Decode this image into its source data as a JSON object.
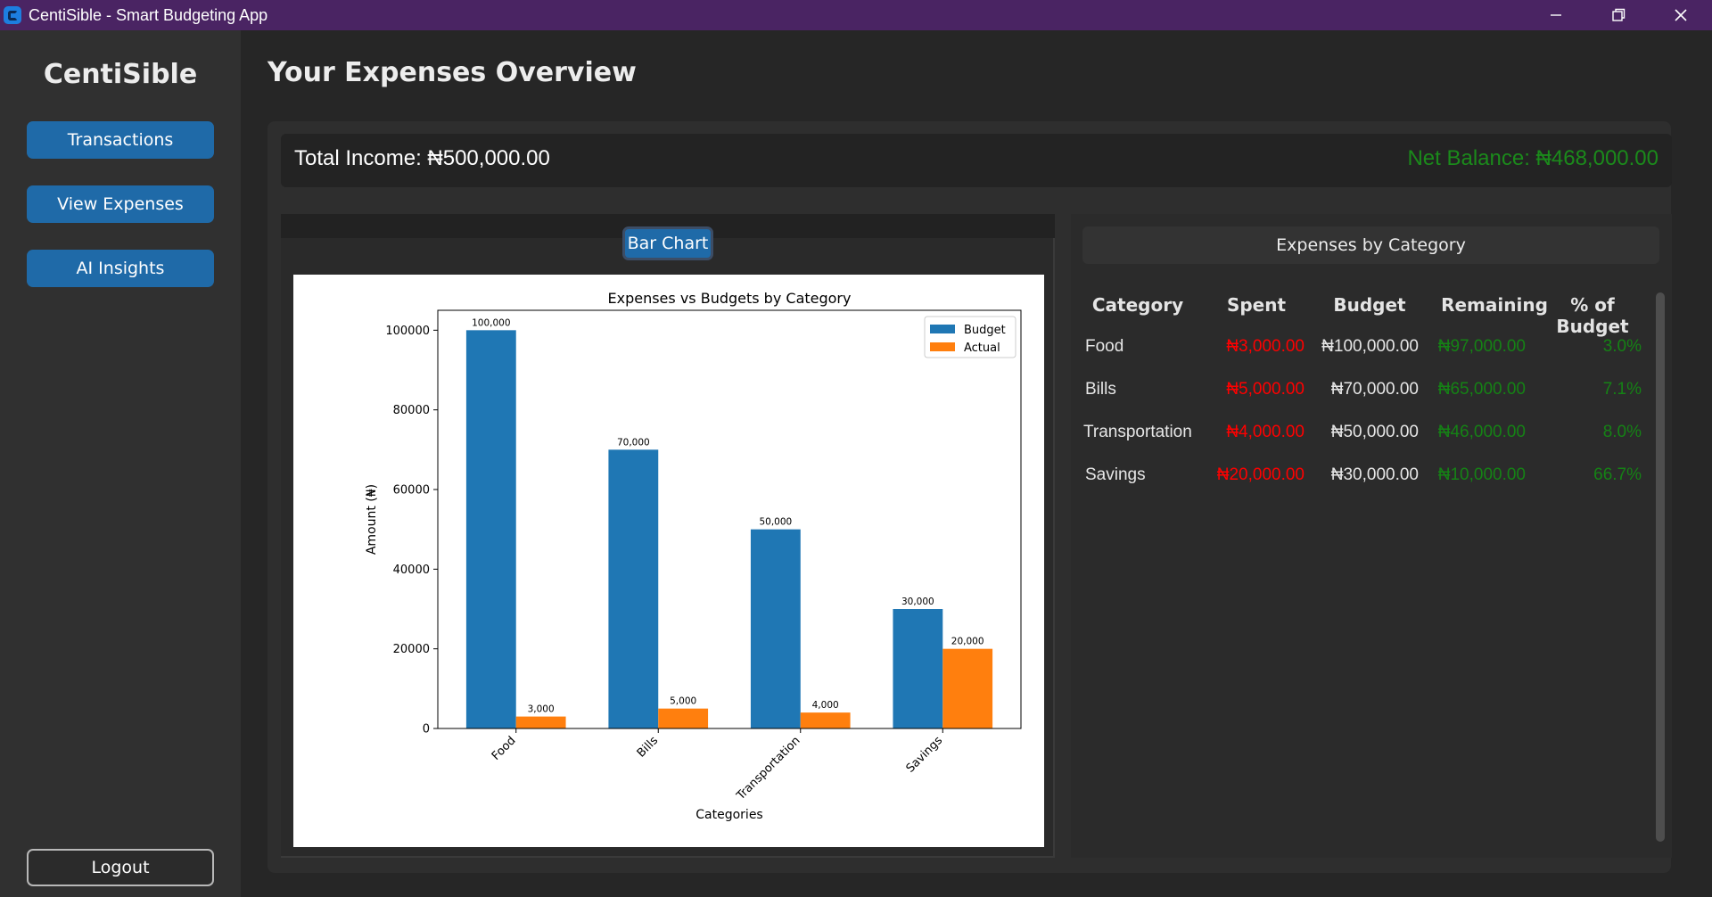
{
  "window": {
    "title": "CentiSible - Smart Budgeting App"
  },
  "sidebar": {
    "brand": "CentiSible",
    "nav": [
      {
        "label": "Transactions"
      },
      {
        "label": "View Expenses"
      },
      {
        "label": "AI Insights"
      }
    ],
    "logout_label": "Logout"
  },
  "page": {
    "title": "Your Expenses Overview"
  },
  "summary": {
    "income": "Total Income: ₦500,000.00",
    "balance": "Net Balance: ₦468,000.00"
  },
  "chart_tab": {
    "label": "Bar Chart"
  },
  "table": {
    "title": "Expenses by Category",
    "headers": [
      "Category",
      "Spent",
      "Budget",
      "Remaining",
      "% of Budget"
    ],
    "rows": [
      {
        "category": "Food",
        "spent": "₦3,000.00",
        "budget": "₦100,000.00",
        "remaining": "₦97,000.00",
        "percent": "3.0%"
      },
      {
        "category": "Bills",
        "spent": "₦5,000.00",
        "budget": "₦70,000.00",
        "remaining": "₦65,000.00",
        "percent": "7.1%"
      },
      {
        "category": "Transportation",
        "spent": "₦4,000.00",
        "budget": "₦50,000.00",
        "remaining": "₦46,000.00",
        "percent": "8.0%"
      },
      {
        "category": "Savings",
        "spent": "₦20,000.00",
        "budget": "₦30,000.00",
        "remaining": "₦10,000.00",
        "percent": "66.7%"
      }
    ]
  },
  "colors": {
    "titlebar": "#4a2463",
    "button": "#1f6aa8",
    "budget_bar": "#1f77b4",
    "actual_bar": "#ff7f0e",
    "spent_text": "#ff0000",
    "remaining_text": "#158215"
  },
  "icons": {
    "app": "app-logo-icon",
    "minimize": "minimize-icon",
    "restore": "restore-icon",
    "close": "close-icon"
  },
  "chart_data": {
    "type": "bar",
    "title": "Expenses vs Budgets by Category",
    "xlabel": "Categories",
    "ylabel": "Amount (₦)",
    "categories": [
      "Food",
      "Bills",
      "Transportation",
      "Savings"
    ],
    "series": [
      {
        "name": "Budget",
        "values": [
          100000,
          70000,
          50000,
          30000
        ],
        "labels": [
          "100,000",
          "70,000",
          "50,000",
          "30,000"
        ]
      },
      {
        "name": "Actual",
        "values": [
          3000,
          5000,
          4000,
          20000
        ],
        "labels": [
          "3,000",
          "5,000",
          "4,000",
          "20,000"
        ]
      }
    ],
    "ylim": [
      0,
      105000
    ],
    "yticks": [
      0,
      20000,
      40000,
      60000,
      80000,
      100000
    ],
    "grid": false,
    "legend_position": "top-right"
  }
}
